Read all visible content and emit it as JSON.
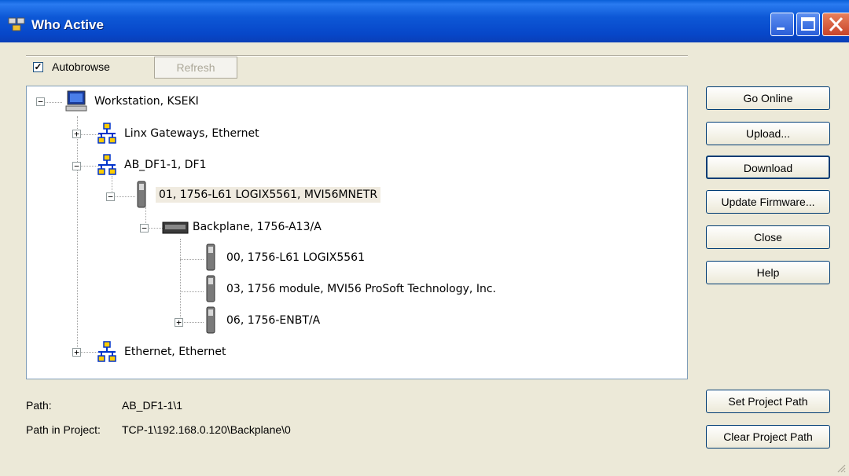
{
  "window": {
    "title": "Who Active",
    "colors": {
      "titlebar": "#0a58d6",
      "face": "#ece9d8",
      "tree_bg": "#ffffff",
      "network_icon": "#0033cc",
      "network_box": "#ffcc00"
    }
  },
  "toolbar": {
    "autobrowse_label": "Autobrowse",
    "autobrowse_checked": true,
    "refresh_label": "Refresh"
  },
  "tree": {
    "workstation": "Workstation, KSEKI",
    "linx": "Linx Gateways, Ethernet",
    "df1": "AB_DF1-1, DF1",
    "processor": "01, 1756-L61 LOGIX5561, MVI56MNETR",
    "backplane": "Backplane, 1756-A13/A",
    "slot00": "00, 1756-L61 LOGIX5561",
    "slot03": "03, 1756 module, MVI56 ProSoft Technology, Inc.",
    "slot06": "06, 1756-ENBT/A",
    "ethernet": "Ethernet, Ethernet"
  },
  "buttons": {
    "go_online": "Go Online",
    "upload": "Upload...",
    "download": "Download",
    "update_firmware": "Update Firmware...",
    "close": "Close",
    "help": "Help",
    "set_project_path": "Set Project Path",
    "clear_project_path": "Clear Project Path"
  },
  "path": {
    "path_label": "Path:",
    "path_value": "AB_DF1-1\\1",
    "project_label": "Path in Project:",
    "project_value": "TCP-1\\192.168.0.120\\Backplane\\0"
  }
}
